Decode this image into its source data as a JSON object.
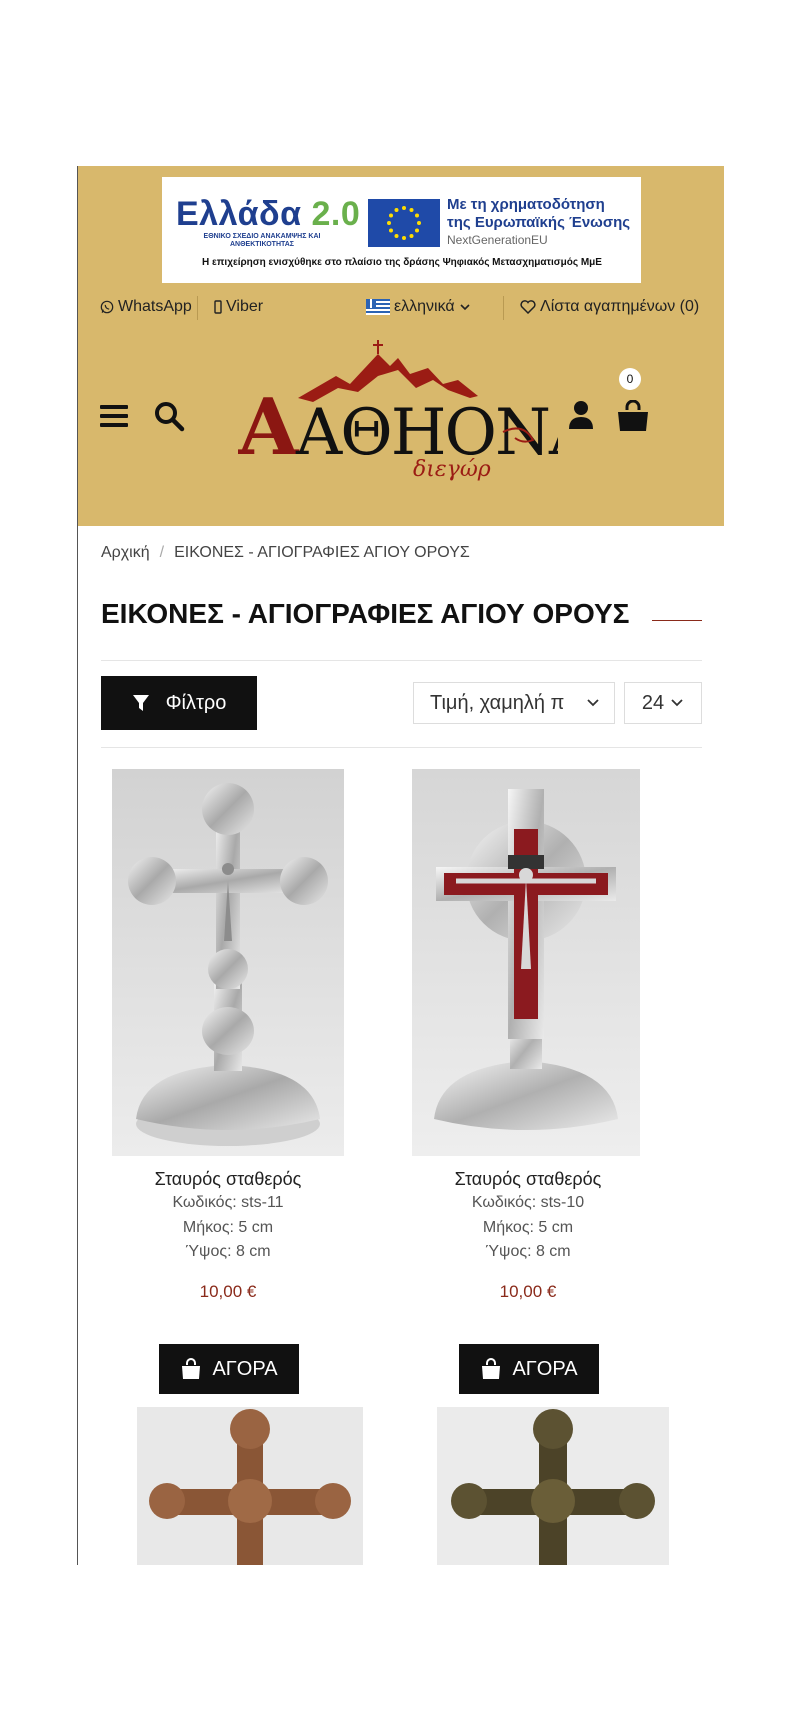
{
  "banner": {
    "greece_title": "Ελλάδα",
    "greece_version": "2.0",
    "greece_sub": "ΕΘΝΙΚΟ ΣΧΕΔΙΟ ΑΝΑΚΑΜΨΗΣ ΚΑΙ ΑΝΘΕΚΤΙΚΟΤΗΤΑΣ",
    "eu_line1": "Με τη χρηματοδότηση",
    "eu_line2": "της Ευρωπαϊκής Ένωσης",
    "eu_line3": "NextGenerationEU",
    "note": "Η επιχείρηση ενισχύθηκε στο πλαίσιο της δράσης Ψηφιακός Μετασχηματισμός ΜμΕ"
  },
  "topbar": {
    "whatsapp": "WhatsApp",
    "viber": "Viber",
    "language": "ελληνικά",
    "wishlist": "Λίστα αγαπημένων (0)"
  },
  "nav": {
    "cart_count": "0",
    "logo_text": "ΑΘΗΟΝΑΣ"
  },
  "breadcrumb": {
    "home": "Αρχική",
    "separator": "/",
    "current": "ΕΙΚΟΝΕΣ - ΑΓΙΟΓΡΑΦΙΕΣ ΑΓΙΟΥ ΟΡΟΥΣ"
  },
  "page": {
    "title": "ΕΙΚΟΝΕΣ - ΑΓΙΟΓΡΑΦΙΕΣ ΑΓΙΟΥ ΟΡΟΥΣ"
  },
  "toolbar": {
    "filter_label": "Φίλτρο",
    "sort_value": "Τιμή, χαμηλή π",
    "per_page_value": "24"
  },
  "products": [
    {
      "name": "Σταυρός σταθερός",
      "code": "Κωδικός: sts-11",
      "length": "Μήκος: 5 cm",
      "height": "Ύψος: 8 cm",
      "price": "10,00 €",
      "buy_label": "ΑΓΟΡΑ"
    },
    {
      "name": "Σταυρός σταθερός",
      "code": "Κωδικός: sts-10",
      "length": "Μήκος: 5 cm",
      "height": "Ύψος: 8 cm",
      "price": "10,00 €",
      "buy_label": "ΑΓΟΡΑ"
    }
  ],
  "colors": {
    "header_bg": "#d8b86c",
    "accent": "#8a2a1a",
    "button_bg": "#111111"
  }
}
